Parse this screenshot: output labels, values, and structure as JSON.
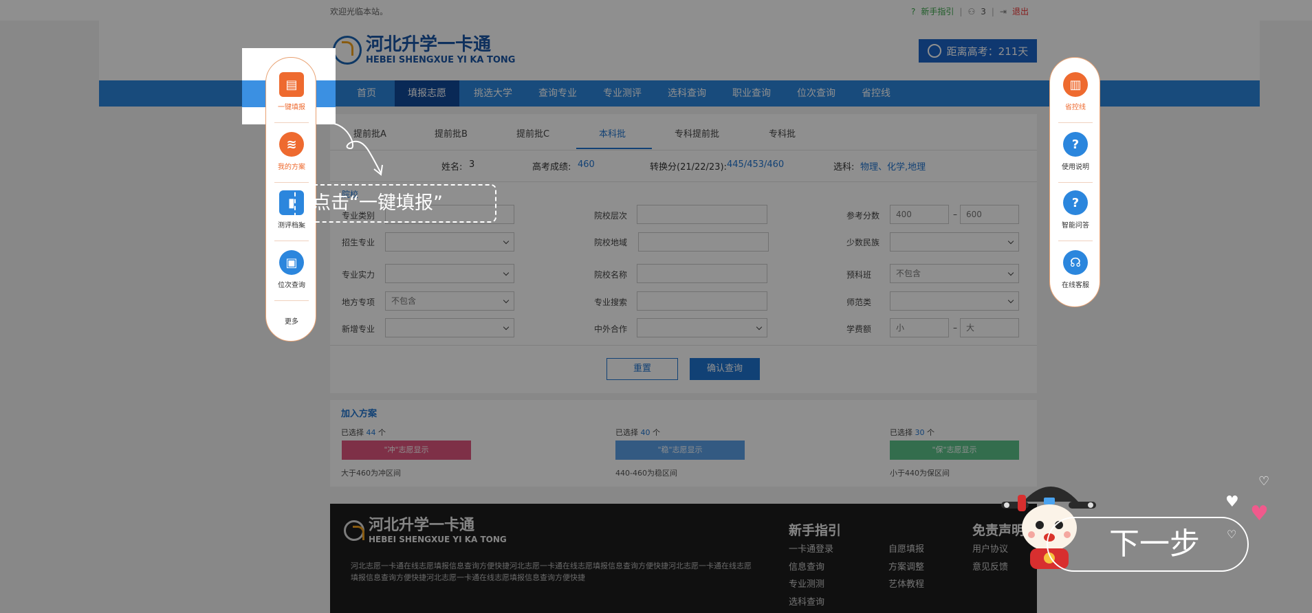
{
  "topbar": {
    "welcome": "欢迎光临本站。",
    "guide": "新手指引",
    "user": "3",
    "sep": "|",
    "logout": "退出"
  },
  "header": {
    "logo_cn": "河北升学一卡通",
    "logo_en": "HEBEI SHENGXUE YI KA TONG",
    "countdown": "距离高考：211天"
  },
  "nav": {
    "items": [
      "首页",
      "填报志愿",
      "挑选大学",
      "查询专业",
      "专业测评",
      "选科查询",
      "职业查询",
      "位次查询",
      "省控线"
    ],
    "active": "填报志愿"
  },
  "tabs": {
    "items": [
      "提前批A",
      "提前批B",
      "提前批C",
      "本科批",
      "专科提前批",
      "专科批"
    ],
    "active": "本科批"
  },
  "info": {
    "name_label": "姓名:",
    "name": "3",
    "score_label": "高考成绩:",
    "score": "460",
    "convert_label": "转换分(21/22/23):",
    "convert": "445/453/460",
    "subjects_label": "选科:",
    "subjects": "物理、化学,地理"
  },
  "filters": {
    "section_label": "院校",
    "major_type": "专业类别",
    "school_level": "院校层次",
    "ref_score": "参考分数",
    "ref_min": "400",
    "ref_dash": "–",
    "ref_max": "600",
    "enroll_major": "招生专业",
    "school_region": "院校地域",
    "minority": "少数民族",
    "major_strength": "专业实力",
    "school_name": "院校名称",
    "prep_class": "预科班",
    "prep_value": "不包含",
    "local_special": "地方专项",
    "local_value": "不包含",
    "major_search": "专业搜索",
    "normal": "师范类",
    "new_major": "新增专业",
    "sino_foreign": "中外合作",
    "tuition": "学费额",
    "tuition_min": "小",
    "tuition_dash": "–",
    "tuition_max": "大"
  },
  "buttons": {
    "reset": "重置",
    "confirm": "确认查询"
  },
  "plan": {
    "title": "加入方案",
    "selected_prefix": "已选择",
    "unit": "个",
    "groups": [
      {
        "count": "44",
        "bar": "\"冲\"志愿显示",
        "note": "大于460为冲区间",
        "color": "#e0567f"
      },
      {
        "count": "40",
        "bar": "\"稳\"志愿显示",
        "note": "440-460为稳区间",
        "color": "#5ba0e8"
      },
      {
        "count": "30",
        "bar": "\"保\"志愿显示",
        "note": "小于440为保区间",
        "color": "#5cc38a"
      }
    ]
  },
  "footer": {
    "logo_cn": "河北升学一卡通",
    "logo_en": "HEBEI SHENGXUE YI KA TONG",
    "desc": "河北志愿一卡通在线志愿填报信息查询方便快捷河北志愿一卡通在线志愿填报信息查询方便快捷河北志愿一卡通在线志愿填报信息查询方便快捷河北志愿一卡通在线志愿填报信息查询方便快捷",
    "col1_title": "新手指引",
    "col1": [
      "一卡通登录",
      "信息查询",
      "专业测测",
      "选科查询"
    ],
    "col2": [
      "自愿填报",
      "方案调整",
      "艺体教程"
    ],
    "col3_title": "免责声明",
    "col3": [
      "用户协议",
      "意见反馈"
    ]
  },
  "sidebar_left": {
    "items": [
      "一键填报",
      "我的方案",
      "测评档案",
      "位次查询",
      "更多"
    ]
  },
  "sidebar_right": {
    "items": [
      "省控线",
      "使用说明",
      "智能问答",
      "在线客服"
    ]
  },
  "guide": {
    "hint": "点击“一键填报”",
    "next": "下一步"
  },
  "colors": {
    "nav_blue": "#2b86dd",
    "nav_active": "#114a9a",
    "accent_orange": "#ee6a2f",
    "link_blue": "#1f74d0"
  }
}
